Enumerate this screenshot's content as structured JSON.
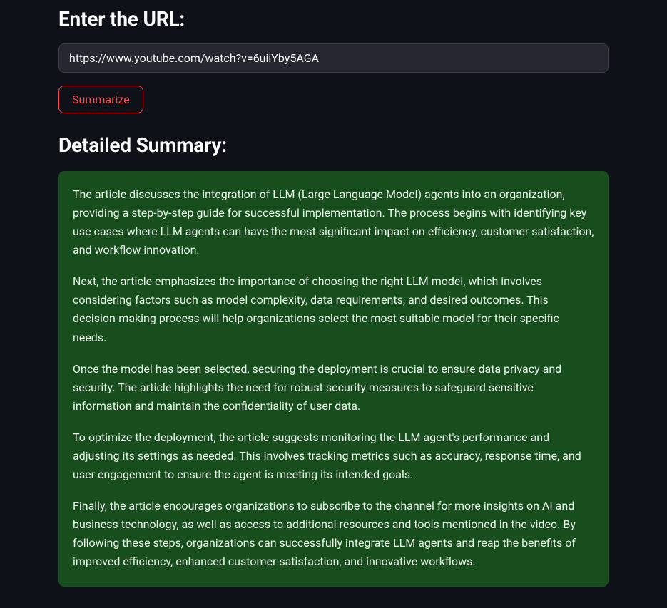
{
  "heading": "Enter the URL:",
  "url_input": {
    "value": "https://www.youtube.com/watch?v=6uiiYby5AGA",
    "placeholder": ""
  },
  "summarize_button_label": "Summarize",
  "summary_heading": "Detailed Summary:",
  "summary_paragraphs": [
    "The article discusses the integration of LLM (Large Language Model) agents into an organization, providing a step-by-step guide for successful implementation. The process begins with identifying key use cases where LLM agents can have the most significant impact on efficiency, customer satisfaction, and workflow innovation.",
    "Next, the article emphasizes the importance of choosing the right LLM model, which involves considering factors such as model complexity, data requirements, and desired outcomes. This decision-making process will help organizations select the most suitable model for their specific needs.",
    "Once the model has been selected, securing the deployment is crucial to ensure data privacy and security. The article highlights the need for robust security measures to safeguard sensitive information and maintain the confidentiality of user data.",
    "To optimize the deployment, the article suggests monitoring the LLM agent's performance and adjusting its settings as needed. This involves tracking metrics such as accuracy, response time, and user engagement to ensure the agent is meeting its intended goals.",
    "Finally, the article encourages organizations to subscribe to the channel for more insights on AI and business technology, as well as access to additional resources and tools mentioned in the video. By following these steps, organizations can successfully integrate LLM agents and reap the benefits of improved efficiency, enhanced customer satisfaction, and innovative workflows."
  ]
}
